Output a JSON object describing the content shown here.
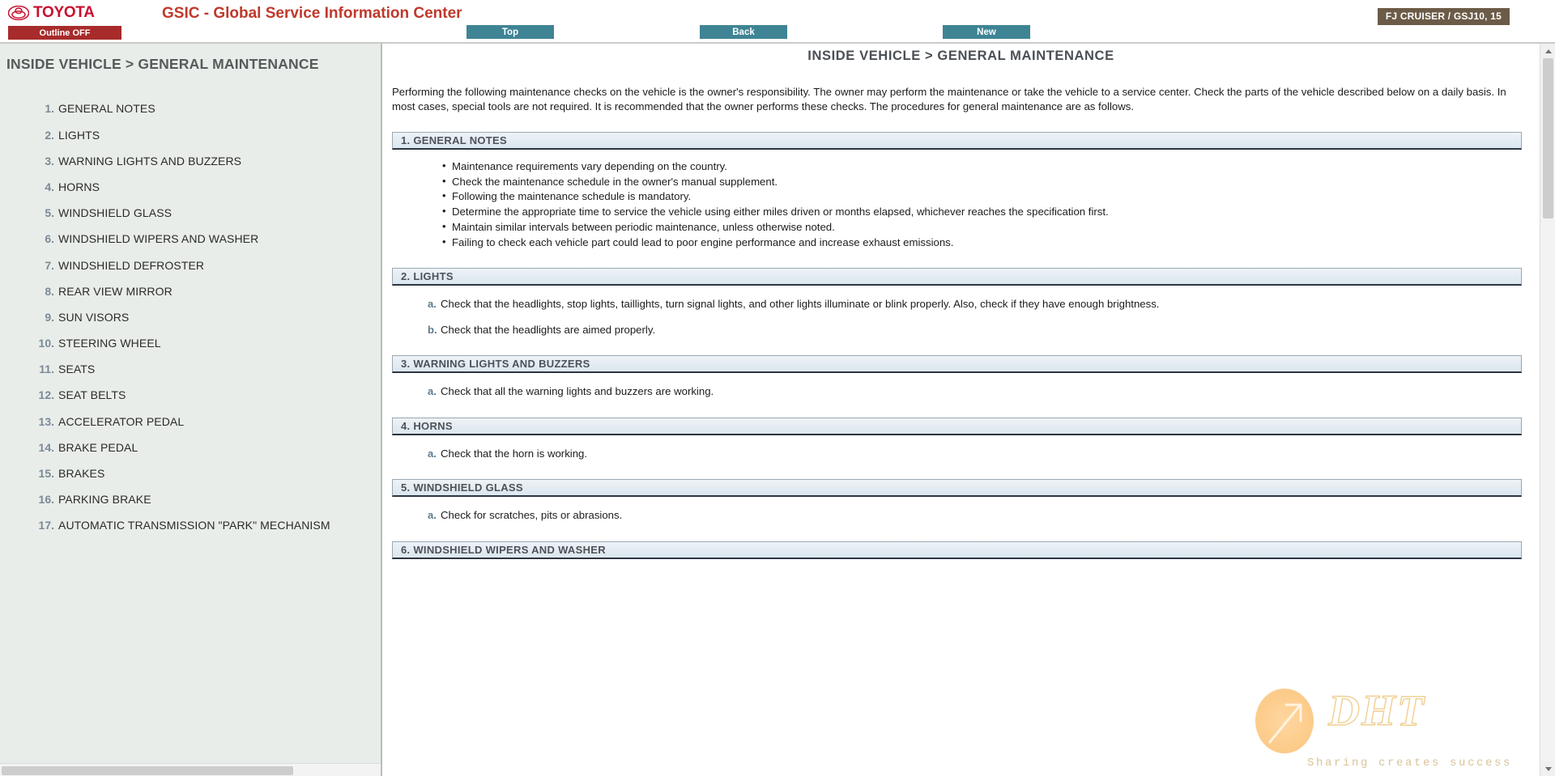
{
  "header": {
    "brand": "TOYOTA",
    "outline_button": "Outline OFF",
    "app_title": "GSIC - Global Service Information Center",
    "nav": {
      "top": "Top",
      "back": "Back",
      "new": "New"
    },
    "vehicle_badge": "FJ CRUISER / GSJ10, 15",
    "colors": {
      "brand_red": "#c8102e",
      "title_red": "#c0392b",
      "outline_btn": "#a82b2b",
      "nav_btn": "#3f8494",
      "badge_bg": "#6b5b47"
    }
  },
  "sidebar": {
    "title": "INSIDE VEHICLE > GENERAL MAINTENANCE",
    "items": [
      {
        "num": "1.",
        "label": "GENERAL NOTES"
      },
      {
        "num": "2.",
        "label": "LIGHTS"
      },
      {
        "num": "3.",
        "label": "WARNING LIGHTS AND BUZZERS"
      },
      {
        "num": "4.",
        "label": "HORNS"
      },
      {
        "num": "5.",
        "label": "WINDSHIELD GLASS"
      },
      {
        "num": "6.",
        "label": "WINDSHIELD WIPERS AND WASHER"
      },
      {
        "num": "7.",
        "label": "WINDSHIELD DEFROSTER"
      },
      {
        "num": "8.",
        "label": "REAR VIEW MIRROR"
      },
      {
        "num": "9.",
        "label": "SUN VISORS"
      },
      {
        "num": "10.",
        "label": "STEERING WHEEL"
      },
      {
        "num": "11.",
        "label": "SEATS"
      },
      {
        "num": "12.",
        "label": "SEAT BELTS"
      },
      {
        "num": "13.",
        "label": "ACCELERATOR PEDAL"
      },
      {
        "num": "14.",
        "label": "BRAKE PEDAL"
      },
      {
        "num": "15.",
        "label": "BRAKES"
      },
      {
        "num": "16.",
        "label": "PARKING BRAKE"
      },
      {
        "num": "17.",
        "label": "AUTOMATIC TRANSMISSION \"PARK\" MECHANISM"
      }
    ]
  },
  "main": {
    "title": "INSIDE VEHICLE > GENERAL MAINTENANCE",
    "intro": "Performing the following maintenance checks on the vehicle is the owner's responsibility. The owner may perform the maintenance or take the vehicle to a service center. Check the parts of the vehicle described below on a daily basis. In most cases, special tools are not required. It is recommended that the owner performs these checks. The procedures for general maintenance are as follows.",
    "sections": [
      {
        "heading": "1. GENERAL NOTES",
        "bullets": [
          "Maintenance requirements vary depending on the country.",
          "Check the maintenance schedule in the owner's manual supplement.",
          "Following the maintenance schedule is mandatory.",
          "Determine the appropriate time to service the vehicle using either miles driven or months elapsed, whichever reaches the specification first.",
          "Maintain similar intervals between periodic maintenance, unless otherwise noted.",
          "Failing to check each vehicle part could lead to poor engine performance and increase exhaust emissions."
        ],
        "lettered": []
      },
      {
        "heading": "2. LIGHTS",
        "bullets": [],
        "lettered": [
          {
            "mark": "a.",
            "text": "Check that the headlights, stop lights, taillights, turn signal lights, and other lights illuminate or blink properly. Also, check if they have enough brightness."
          },
          {
            "mark": "b.",
            "text": "Check that the headlights are aimed properly."
          }
        ]
      },
      {
        "heading": "3. WARNING LIGHTS AND BUZZERS",
        "bullets": [],
        "lettered": [
          {
            "mark": "a.",
            "text": "Check that all the warning lights and buzzers are working."
          }
        ]
      },
      {
        "heading": "4. HORNS",
        "bullets": [],
        "lettered": [
          {
            "mark": "a.",
            "text": "Check that the horn is working."
          }
        ]
      },
      {
        "heading": "5. WINDSHIELD GLASS",
        "bullets": [],
        "lettered": [
          {
            "mark": "a.",
            "text": "Check for scratches, pits or abrasions."
          }
        ]
      },
      {
        "heading": "6. WINDSHIELD WIPERS AND WASHER",
        "bullets": [],
        "lettered": []
      }
    ]
  },
  "watermark": {
    "logo_text": "DHT",
    "tagline": "Sharing creates success"
  }
}
